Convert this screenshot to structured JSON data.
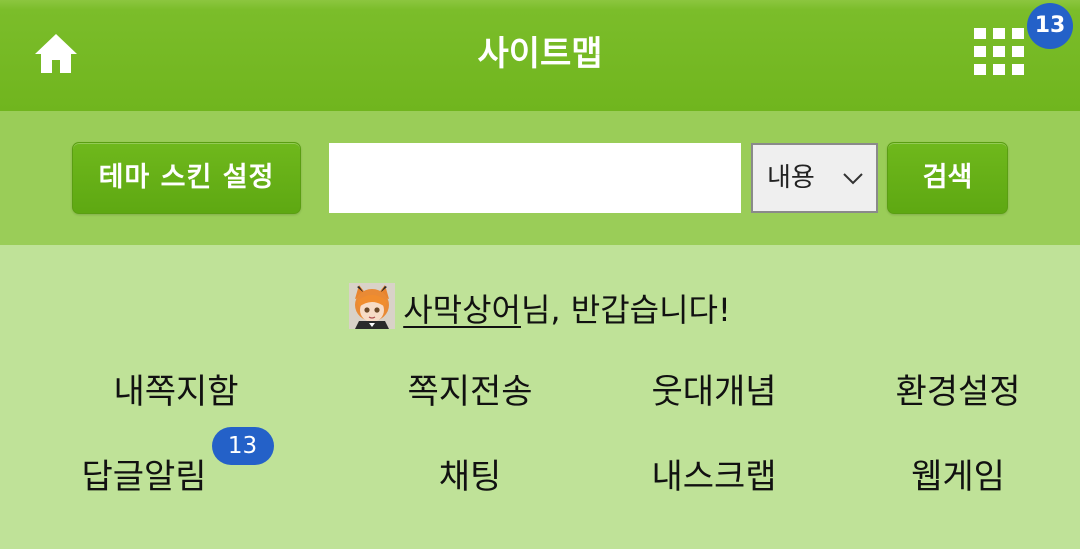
{
  "header": {
    "title": "사이트맵",
    "home_icon": "home-icon",
    "apps_icon": "grid-menu-icon",
    "apps_badge": "13",
    "colors": {
      "header_bg": "#72b61f",
      "badge": "#2461c8"
    }
  },
  "search": {
    "theme_button_label": "테마 스킨 설정",
    "input_value": "",
    "select_value": "내용",
    "search_button_label": "검색",
    "colors": {
      "bar_bg": "#9acd58",
      "button_bg": "#64ad15"
    }
  },
  "greeting": {
    "avatar_icon": "user-avatar",
    "username": "사막상어",
    "suffix": "님, 반갑습니다!"
  },
  "menu": {
    "items": [
      {
        "label": "내쪽지함"
      },
      {
        "label": "쪽지전송"
      },
      {
        "label": "웃대개념"
      },
      {
        "label": "환경설정"
      },
      {
        "label": "답글알림",
        "badge": "13"
      },
      {
        "label": "채팅"
      },
      {
        "label": "내스크랩"
      },
      {
        "label": "웹게임"
      }
    ],
    "colors": {
      "background": "#bfe298",
      "badge": "#2461c8"
    }
  }
}
